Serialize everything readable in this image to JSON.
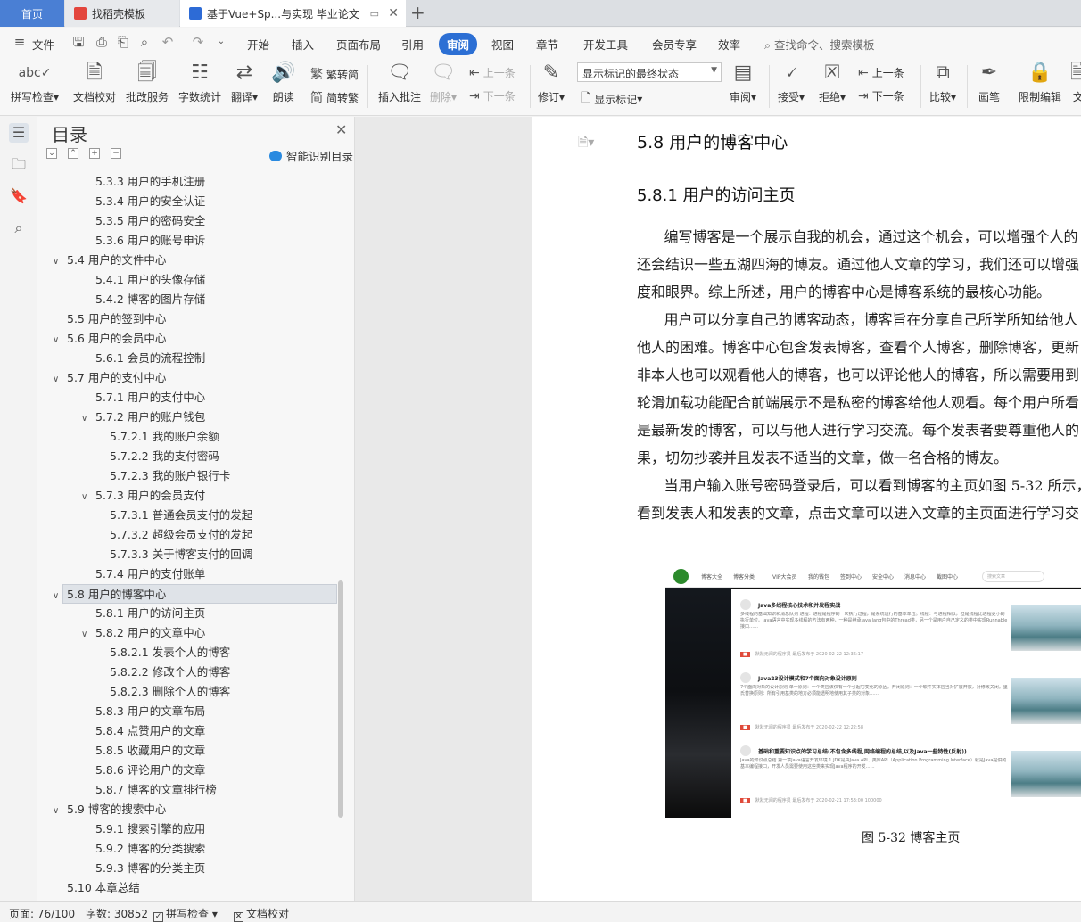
{
  "tabs": {
    "home": "首页",
    "template": "找稻壳模板",
    "doc": "基于Vue+Sp...与实现 毕业论文",
    "add_icon": "plus-icon"
  },
  "menu": {
    "file": "文件",
    "items": [
      "开始",
      "插入",
      "页面布局",
      "引用",
      "审阅",
      "视图",
      "章节",
      "开发工具",
      "会员专享",
      "效率"
    ],
    "active": "审阅",
    "search_placeholder": "查找命令、搜索模板"
  },
  "ribbon": {
    "spell_check": "拼写检查",
    "doc_check": "文档校对",
    "batch_service": "批改服务",
    "word_count": "字数统计",
    "translate": "翻译",
    "read_aloud": "朗读",
    "trad_to_simp": "繁转简",
    "simp_to_trad": "简转繁",
    "insert_comment": "插入批注",
    "delete": "删除",
    "prev": "上一条",
    "next": "下一条",
    "revise": "修订",
    "markup_state": "显示标记的最终状态",
    "show_markup": "显示标记",
    "review": "审阅",
    "accept": "接受",
    "reject": "拒绝",
    "prev2": "上一条",
    "next2": "下一条",
    "compare": "比较",
    "pen": "画笔",
    "restrict_edit": "限制编辑",
    "more": "文"
  },
  "nav": {
    "title": "目录",
    "smart_toc": "智能识别目录",
    "items": [
      {
        "label": "5.3.3  用户的手机注册",
        "level": 3,
        "arrow": ""
      },
      {
        "label": "5.3.4  用户的安全认证",
        "level": 3,
        "arrow": ""
      },
      {
        "label": "5.3.5  用户的密码安全",
        "level": 3,
        "arrow": ""
      },
      {
        "label": "5.3.6  用户的账号申诉",
        "level": 3,
        "arrow": ""
      },
      {
        "label": "5.4  用户的文件中心",
        "level": 2,
        "arrow": "∨"
      },
      {
        "label": "5.4.1  用户的头像存储",
        "level": 3,
        "arrow": ""
      },
      {
        "label": "5.4.2  博客的图片存储",
        "level": 3,
        "arrow": ""
      },
      {
        "label": "5.5  用户的签到中心",
        "level": 2,
        "arrow": ""
      },
      {
        "label": "5.6  用户的会员中心",
        "level": 2,
        "arrow": "∨"
      },
      {
        "label": "5.6.1  会员的流程控制",
        "level": 3,
        "arrow": ""
      },
      {
        "label": "5.7  用户的支付中心",
        "level": 2,
        "arrow": "∨"
      },
      {
        "label": "5.7.1  用户的支付中心",
        "level": 3,
        "arrow": ""
      },
      {
        "label": "5.7.2  用户的账户钱包",
        "level": 3,
        "arrow": "∨"
      },
      {
        "label": "5.7.2.1  我的账户余额",
        "level": 4,
        "arrow": ""
      },
      {
        "label": "5.7.2.2  我的支付密码",
        "level": 4,
        "arrow": ""
      },
      {
        "label": "5.7.2.3  我的账户银行卡",
        "level": 4,
        "arrow": ""
      },
      {
        "label": "5.7.3  用户的会员支付",
        "level": 3,
        "arrow": "∨"
      },
      {
        "label": "5.7.3.1  普通会员支付的发起",
        "level": 4,
        "arrow": ""
      },
      {
        "label": "5.7.3.2  超级会员支付的发起",
        "level": 4,
        "arrow": ""
      },
      {
        "label": "5.7.3.3  关于博客支付的回调",
        "level": 4,
        "arrow": ""
      },
      {
        "label": "5.7.4  用户的支付账单",
        "level": 3,
        "arrow": ""
      },
      {
        "label": "5.8  用户的博客中心",
        "level": 2,
        "arrow": "∨",
        "selected": true
      },
      {
        "label": "5.8.1  用户的访问主页",
        "level": 3,
        "arrow": ""
      },
      {
        "label": "5.8.2  用户的文章中心",
        "level": 3,
        "arrow": "∨"
      },
      {
        "label": "5.8.2.1  发表个人的博客",
        "level": 4,
        "arrow": ""
      },
      {
        "label": "5.8.2.2  修改个人的博客",
        "level": 4,
        "arrow": ""
      },
      {
        "label": "5.8.2.3  删除个人的博客",
        "level": 4,
        "arrow": ""
      },
      {
        "label": "5.8.3  用户的文章布局",
        "level": 3,
        "arrow": ""
      },
      {
        "label": "5.8.4  点赞用户的文章",
        "level": 3,
        "arrow": ""
      },
      {
        "label": "5.8.5  收藏用户的文章",
        "level": 3,
        "arrow": ""
      },
      {
        "label": "5.8.6  评论用户的文章",
        "level": 3,
        "arrow": ""
      },
      {
        "label": "5.8.7  博客的文章排行榜",
        "level": 3,
        "arrow": ""
      },
      {
        "label": "5.9  博客的搜索中心",
        "level": 2,
        "arrow": "∨"
      },
      {
        "label": "5.9.1  搜索引擎的应用",
        "level": 3,
        "arrow": ""
      },
      {
        "label": "5.9.2  博客的分类搜索",
        "level": 3,
        "arrow": ""
      },
      {
        "label": "5.9.3  博客的分类主页",
        "level": 3,
        "arrow": ""
      },
      {
        "label": "5.10  本章总结",
        "level": 2,
        "arrow": ""
      }
    ]
  },
  "doc": {
    "h2": "5.8  用户的博客中心",
    "h3": "5.8.1  用户的访问主页",
    "lines": [
      "      编写博客是一个展示自我的机会，通过这个机会，可以增强个人的",
      "还会结识一些五湖四海的博友。通过他人文章的学习，我们还可以增强",
      "度和眼界。综上所述，用户的博客中心是博客系统的最核心功能。",
      "      用户可以分享自己的博客动态，博客旨在分享自己所学所知给他人",
      "他人的困难。博客中心包含发表博客，查看个人博客，删除博客，更新",
      "非本人也可以观看他人的博客，也可以评论他人的博客，所以需要用到",
      "轮滑加载功能配合前端展示不是私密的博客给他人观看。每个用户所看",
      "是最新发的博客，可以与他人进行学习交流。每个发表者要尊重他人的",
      "果，切勿抄袭并且发表不适当的文章，做一名合格的博友。",
      "      当用户输入账号密码登录后，可以看到博客的主页如图 5-32 所示，",
      "看到发表人和发表的文章，点击文章可以进入文章的主页面进行学习交"
    ],
    "figure": {
      "nav": [
        "博客大全",
        "博客分类",
        "VIP大会员",
        "我的钱包",
        "签到中心",
        "安全中心",
        "消息中心",
        "截图中心"
      ],
      "search": "搜索文章",
      "cards": [
        {
          "title": "Java多线程核心技术和并发程实战",
          "body": "多线程的基础知识和消息队列 进程：进程是程序的一次执行过程，是系统运行的基本单位。线程：与进程相似，但是线程比进程更小的执行单位。java语言中实现多线程的方法有两种，一种是继承Java.lang包中的Thread类，另一个是用户自己定义的类中实现Runnable接口……",
          "meta": "默默无闻的程序员    最后发布于 2020-02-22 12:36:17"
        },
        {
          "title": "Java23设计模式和7个面向对象设计原则",
          "body": "7个面向对象的设计原则 单一原则：一个类应该仅有一个引起它变化的原因。开闭原则：一个软件实体应当对扩展开放，对修改关闭。里氏替换原则：所有引用基类的地方必须能透明地使用其子类的对象……",
          "meta": "默默无闻的程序员    最后发布于 2020-02-22 12:22:58"
        },
        {
          "title": "基础和重要知识点的学习总结(不包含多线程,网络编程的总结,以及Java一些特性(反射))",
          "body": "Java的知识点总结 第一章Java语言开发环境 1.JDK是由Java API、类库API（Application Programming Interface）就是Java提供的基本编程接口，开发人员需要使用这些类来实现Java程序的开发……",
          "meta": "默默无闻的程序员    最后发布于 2020-02-21 17:53:00    100000"
        }
      ],
      "caption": "图 5-32  博客主页"
    }
  },
  "status": {
    "page": "页面: 76/100",
    "words": "字数: 30852",
    "spell": "拼写检查",
    "check": "文档校对"
  }
}
